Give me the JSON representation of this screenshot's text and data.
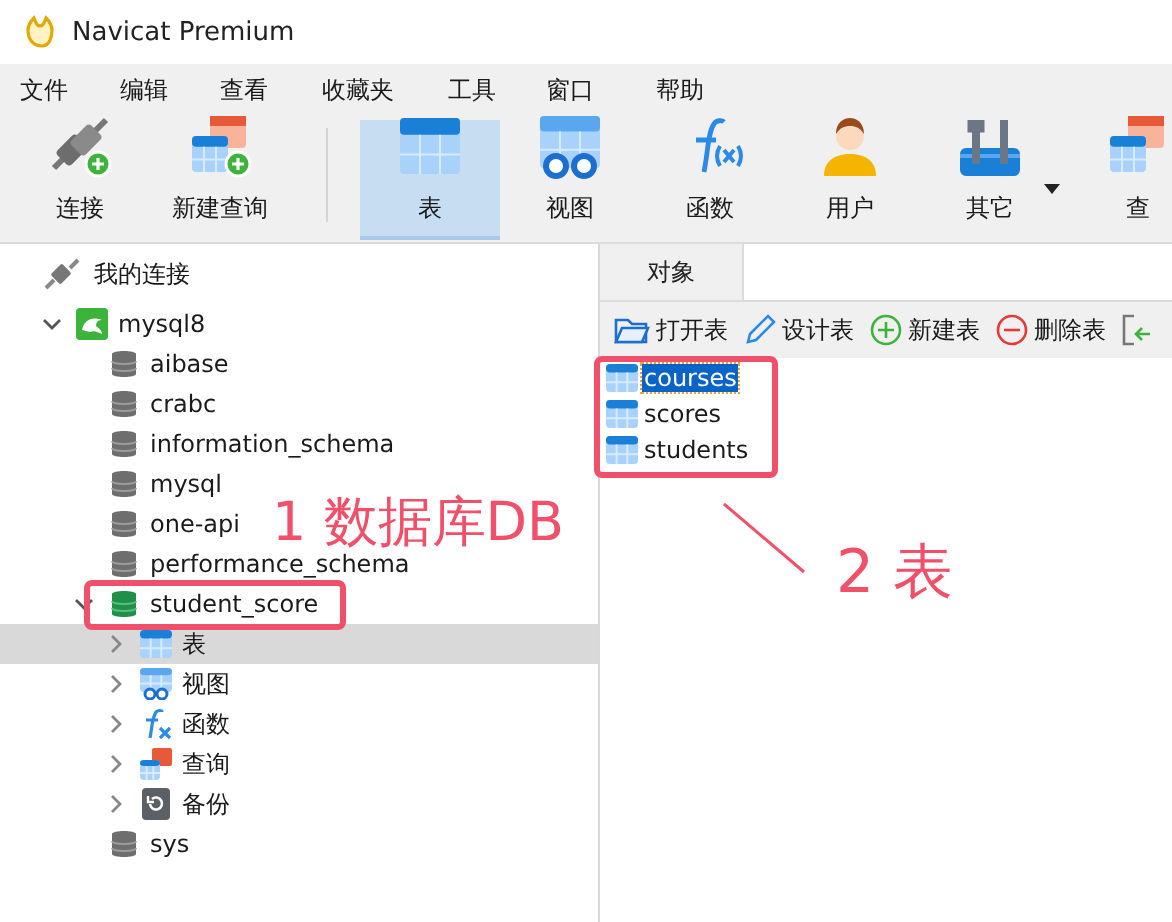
{
  "window": {
    "title": "Navicat Premium"
  },
  "menu": [
    "文件",
    "编辑",
    "查看",
    "收藏夹",
    "工具",
    "窗口",
    "帮助"
  ],
  "toolbar": [
    {
      "label": "连接",
      "kind": "connect",
      "selected": false
    },
    {
      "label": "新建查询",
      "kind": "newquery",
      "selected": false
    },
    {
      "label": "表",
      "kind": "table",
      "selected": true
    },
    {
      "label": "视图",
      "kind": "view",
      "selected": false
    },
    {
      "label": "函数",
      "kind": "function",
      "selected": false
    },
    {
      "label": "用户",
      "kind": "user",
      "selected": false
    },
    {
      "label": "其它",
      "kind": "tools",
      "selected": false,
      "dropdown": true
    },
    {
      "label": "查",
      "kind": "query",
      "selected": false
    }
  ],
  "connections_header": "我的连接",
  "tree": [
    {
      "label": "mysql8",
      "kind": "server",
      "expanded": true,
      "selected": false,
      "children": [
        {
          "label": "aibase",
          "kind": "database",
          "selected": false
        },
        {
          "label": "crabc",
          "kind": "database",
          "selected": false
        },
        {
          "label": "information_schema",
          "kind": "database",
          "selected": false
        },
        {
          "label": "mysql",
          "kind": "database",
          "selected": false
        },
        {
          "label": "one-api",
          "kind": "database",
          "selected": false
        },
        {
          "label": "performance_schema",
          "kind": "database",
          "selected": false
        },
        {
          "label": "student_score",
          "kind": "database_open",
          "expanded": true,
          "selected": false,
          "children": [
            {
              "label": "表",
              "kind": "tables",
              "expanded": false,
              "selected": true
            },
            {
              "label": "视图",
              "kind": "views",
              "expanded": false,
              "selected": false
            },
            {
              "label": "函数",
              "kind": "functions",
              "expanded": false,
              "selected": false
            },
            {
              "label": "查询",
              "kind": "queries",
              "expanded": false,
              "selected": false
            },
            {
              "label": "备份",
              "kind": "backups",
              "expanded": false,
              "selected": false
            }
          ]
        },
        {
          "label": "sys",
          "kind": "database",
          "selected": false
        }
      ]
    }
  ],
  "object_tabs": [
    {
      "label": "对象",
      "selected": true
    }
  ],
  "object_toolbar": [
    {
      "label": "打开表",
      "kind": "open"
    },
    {
      "label": "设计表",
      "kind": "design"
    },
    {
      "label": "新建表",
      "kind": "new"
    },
    {
      "label": "删除表",
      "kind": "delete"
    },
    {
      "kind": "import"
    }
  ],
  "tables": [
    {
      "name": "courses",
      "selected": true
    },
    {
      "name": "scores",
      "selected": false
    },
    {
      "name": "students",
      "selected": false
    }
  ],
  "annotations": [
    {
      "kind": "database",
      "text": "1 数据库DB"
    },
    {
      "kind": "tables",
      "text": "2 表"
    }
  ]
}
